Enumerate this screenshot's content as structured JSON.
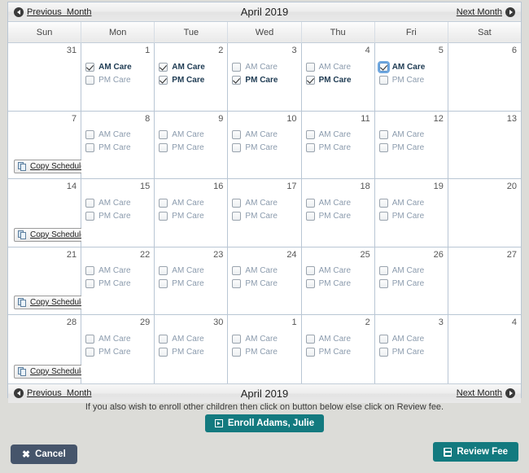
{
  "nav": {
    "prev_label": "Previous  Month",
    "next_label": "Next Month",
    "title": "April 2019",
    "prev_icon": "circle-left-arrow-icon",
    "next_icon": "circle-right-arrow-icon"
  },
  "weekdays": [
    "Sun",
    "Mon",
    "Tue",
    "Wed",
    "Thu",
    "Fri",
    "Sat"
  ],
  "care_labels": {
    "am": "AM Care",
    "pm": "PM Care"
  },
  "copy_schedule_label": "Copy Schedule",
  "weeks": [
    {
      "copy_schedule": false,
      "days": [
        {
          "num": "31",
          "care": false
        },
        {
          "num": "1",
          "care": true,
          "am": true,
          "pm": false
        },
        {
          "num": "2",
          "care": true,
          "am": true,
          "pm": true
        },
        {
          "num": "3",
          "care": true,
          "am": false,
          "pm": true
        },
        {
          "num": "4",
          "care": true,
          "am": false,
          "pm": true
        },
        {
          "num": "5",
          "care": true,
          "am": true,
          "pm": false,
          "am_focused": true
        },
        {
          "num": "6",
          "care": false
        }
      ]
    },
    {
      "copy_schedule": true,
      "days": [
        {
          "num": "7",
          "care": false
        },
        {
          "num": "8",
          "care": true,
          "am": false,
          "pm": false
        },
        {
          "num": "9",
          "care": true,
          "am": false,
          "pm": false
        },
        {
          "num": "10",
          "care": true,
          "am": false,
          "pm": false
        },
        {
          "num": "11",
          "care": true,
          "am": false,
          "pm": false
        },
        {
          "num": "12",
          "care": true,
          "am": false,
          "pm": false
        },
        {
          "num": "13",
          "care": false
        }
      ]
    },
    {
      "copy_schedule": true,
      "days": [
        {
          "num": "14",
          "care": false
        },
        {
          "num": "15",
          "care": true,
          "am": false,
          "pm": false
        },
        {
          "num": "16",
          "care": true,
          "am": false,
          "pm": false
        },
        {
          "num": "17",
          "care": true,
          "am": false,
          "pm": false
        },
        {
          "num": "18",
          "care": true,
          "am": false,
          "pm": false
        },
        {
          "num": "19",
          "care": true,
          "am": false,
          "pm": false
        },
        {
          "num": "20",
          "care": false
        }
      ]
    },
    {
      "copy_schedule": true,
      "days": [
        {
          "num": "21",
          "care": false
        },
        {
          "num": "22",
          "care": true,
          "am": false,
          "pm": false
        },
        {
          "num": "23",
          "care": true,
          "am": false,
          "pm": false
        },
        {
          "num": "24",
          "care": true,
          "am": false,
          "pm": false
        },
        {
          "num": "25",
          "care": true,
          "am": false,
          "pm": false
        },
        {
          "num": "26",
          "care": true,
          "am": false,
          "pm": false
        },
        {
          "num": "27",
          "care": false
        }
      ]
    },
    {
      "copy_schedule": true,
      "days": [
        {
          "num": "28",
          "care": false
        },
        {
          "num": "29",
          "care": true,
          "am": false,
          "pm": false
        },
        {
          "num": "30",
          "care": true,
          "am": false,
          "pm": false
        },
        {
          "num": "1",
          "care": true,
          "am": false,
          "pm": false
        },
        {
          "num": "2",
          "care": true,
          "am": false,
          "pm": false
        },
        {
          "num": "3",
          "care": true,
          "am": false,
          "pm": false
        },
        {
          "num": "4",
          "care": false
        }
      ]
    }
  ],
  "footer": {
    "note": "If you also wish to enroll other children then click on button below else click on Review fee.",
    "enroll_label": "Enroll Adams, Julie",
    "cancel_label": "Cancel",
    "review_label": "Review Fee"
  },
  "colors": {
    "teal": "#137a7f",
    "slate": "#46556b",
    "page_bg": "#dcdcd8",
    "frame_border": "#b9c6d4",
    "checked_text": "#1d3a52",
    "unchecked_text": "#8b9bad",
    "focus_ring": "#6fa8e0"
  }
}
